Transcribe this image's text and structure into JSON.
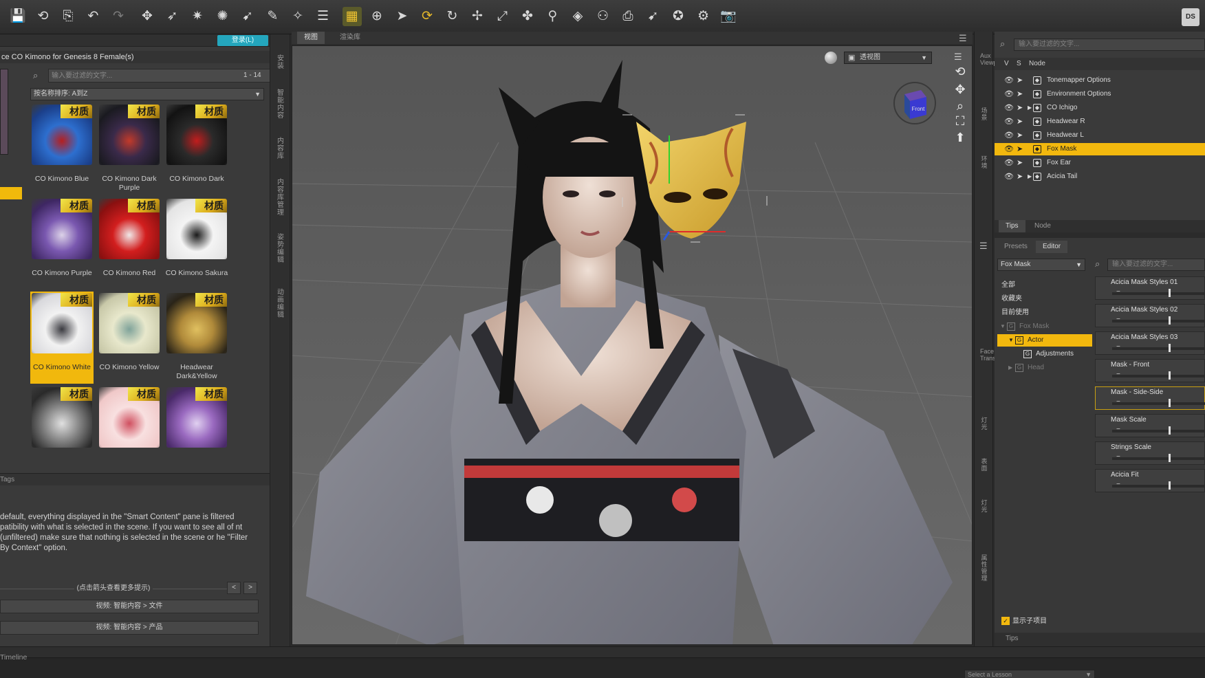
{
  "toolbar": {
    "buttons": [
      {
        "icon": "save-icon",
        "glyph": "💾"
      },
      {
        "icon": "undo-history-icon",
        "glyph": "⟲"
      },
      {
        "icon": "export-icon",
        "glyph": "⎘"
      },
      {
        "icon": "undo-icon",
        "glyph": "↶"
      },
      {
        "icon": "redo-icon",
        "glyph": "↷"
      },
      {
        "icon": "joint-editor-icon",
        "glyph": "✥"
      },
      {
        "icon": "active-pose-icon",
        "glyph": "➶"
      },
      {
        "icon": "node-weight-icon",
        "glyph": "✷"
      },
      {
        "icon": "geometry-editor-icon",
        "glyph": "✺"
      },
      {
        "icon": "transfer-icon",
        "glyph": "➹"
      },
      {
        "icon": "surface-selection-icon",
        "glyph": "✎"
      },
      {
        "icon": "spotrender-icon",
        "glyph": "✧"
      },
      {
        "icon": "align-icon",
        "glyph": "☰"
      },
      {
        "icon": "grid-icon",
        "glyph": "▦"
      },
      {
        "icon": "universal-tool-icon",
        "glyph": "⊕"
      },
      {
        "icon": "select-arrow-icon",
        "glyph": "➤"
      },
      {
        "icon": "rotate-gold-icon",
        "glyph": "⟳"
      },
      {
        "icon": "rotate-icon",
        "glyph": "↻"
      },
      {
        "icon": "translate-icon",
        "glyph": "✢"
      },
      {
        "icon": "scale-icon",
        "glyph": "⤢"
      },
      {
        "icon": "tweak-icon",
        "glyph": "✤"
      },
      {
        "icon": "figure-icon",
        "glyph": "⚲"
      },
      {
        "icon": "node-select-icon",
        "glyph": "◈"
      },
      {
        "icon": "group-icon",
        "glyph": "⚇"
      },
      {
        "icon": "camera-add-icon",
        "glyph": "⎙"
      },
      {
        "icon": "pointer-icon",
        "glyph": "➹"
      },
      {
        "icon": "spotlight-icon",
        "glyph": "✪"
      },
      {
        "icon": "render-settings-icon",
        "glyph": "⚙"
      },
      {
        "icon": "render-camera-icon",
        "glyph": "📷"
      }
    ],
    "logo": "DS"
  },
  "content_panel": {
    "login_label": "登录(L)",
    "product_title": "ce CO Kimono for Genesis 8 Female(s)",
    "search_placeholder": "输入要过滤的文字...",
    "range": "1 - 14",
    "sort_label": "按名称排序: A到Z",
    "badge": "材质",
    "items": [
      {
        "label": "CO Kimono Blue",
        "colors": [
          "#1b3f8a",
          "#2d6fcf",
          "#b51f1f"
        ]
      },
      {
        "label": "CO Kimono Dark Purple",
        "colors": [
          "#1a1a20",
          "#3a2a4a",
          "#c23a2a"
        ]
      },
      {
        "label": "CO Kimono Dark",
        "colors": [
          "#121212",
          "#2a2a2a",
          "#c21d1d"
        ]
      },
      {
        "label": "CO Kimono Purple",
        "colors": [
          "#3e2763",
          "#7a58b0",
          "#dcd2e8"
        ]
      },
      {
        "label": "CO Kimono Red",
        "colors": [
          "#8a1010",
          "#d21e1e",
          "#f0e8e8"
        ]
      },
      {
        "label": "CO Kimono Sakura",
        "colors": [
          "#e4e4e4",
          "#f4f4f4",
          "#1a1a1a"
        ]
      },
      {
        "label": "CO Kimono White",
        "colors": [
          "#d8d8dc",
          "#f2f2f2",
          "#3a3a40"
        ]
      },
      {
        "label": "CO Kimono Yellow",
        "colors": [
          "#c8c8a8",
          "#e8e8cc",
          "#7fa39a"
        ]
      },
      {
        "label": "Headwear Dark&Yellow",
        "colors": [
          "#2a2418",
          "#b08a3a",
          "#e0c060"
        ]
      },
      {
        "label": "",
        "colors": [
          "#2a2a2a",
          "#8a8a8a",
          "#e0e0e0"
        ]
      },
      {
        "label": "",
        "colors": [
          "#f0c8c8",
          "#f8e0e0",
          "#d05060"
        ]
      },
      {
        "label": "",
        "colors": [
          "#4a2a6a",
          "#9a6ac0",
          "#e0d0f0"
        ]
      }
    ],
    "tags_label": "Tags",
    "tips_text": "default, everything displayed in the \"Smart Content\" pane is filtered patibility with what is selected in the scene. If you want to see all of nt (unfiltered) make sure that nothing is selected in the scene or he \"Filter By Context\" option.",
    "hint": "(点击箭头查看更多提示)",
    "prev": "<",
    "next": ">",
    "link_files": "视频: 智能内容 > 文件",
    "link_products": "视频: 智能内容 > 产品"
  },
  "left_vtabs": [
    "安装",
    "智能内容",
    "内容库",
    "内容库管理",
    "姿势编辑",
    "动画编辑"
  ],
  "viewport": {
    "tabs": [
      "视图",
      "渲染库"
    ],
    "view_select": "透视图",
    "cube_label": "Front"
  },
  "right_vtabs": [
    "Aux Viewport",
    "场景",
    "环境",
    "Face Transfer",
    "灯光",
    "表面",
    "灯光",
    "属性管理"
  ],
  "scene_panel": {
    "search_placeholder": "输入要过滤的文字...",
    "columns": [
      "V",
      "S",
      "Node"
    ],
    "nodes": [
      {
        "label": "Tonemapper Options",
        "expandable": false,
        "selected": false
      },
      {
        "label": "Environment Options",
        "expandable": false,
        "selected": false
      },
      {
        "label": "CO Ichigo",
        "expandable": true,
        "selected": false
      },
      {
        "label": "Headwear R",
        "expandable": false,
        "selected": false
      },
      {
        "label": "Headwear L",
        "expandable": false,
        "selected": false
      },
      {
        "label": "Fox Mask",
        "expandable": false,
        "selected": true
      },
      {
        "label": "Fox Ear",
        "expandable": false,
        "selected": false
      },
      {
        "label": "Acicia Tail",
        "expandable": true,
        "selected": false
      }
    ],
    "tabs": [
      "Tips",
      "Node"
    ]
  },
  "param_panel": {
    "tabs": [
      "Presets",
      "Editor"
    ],
    "node_select": "Fox Mask",
    "search_placeholder": "输入要过滤的文字...",
    "tree": [
      {
        "label": "全部",
        "indent": 0,
        "state": "normal"
      },
      {
        "label": "收藏夹",
        "indent": 0,
        "state": "normal"
      },
      {
        "label": "目前使用",
        "indent": 0,
        "state": "normal"
      },
      {
        "label": "Fox Mask",
        "indent": 0,
        "state": "dimmed"
      },
      {
        "label": "Actor",
        "indent": 1,
        "state": "selected"
      },
      {
        "label": "Adjustments",
        "indent": 2,
        "state": "normal"
      },
      {
        "label": "Head",
        "indent": 1,
        "state": "dimmed"
      }
    ],
    "sliders": [
      {
        "label": "Acicia Mask Styles 01",
        "value": 0.6
      },
      {
        "label": "Acicia Mask Styles 02",
        "value": 0.6
      },
      {
        "label": "Acicia Mask Styles 03",
        "value": 0.6
      },
      {
        "label": "Mask - Front",
        "value": 0.6
      },
      {
        "label": "Mask - Side-Side",
        "value": 0.6
      },
      {
        "label": "Mask Scale",
        "value": 0.6
      },
      {
        "label": "Strings Scale",
        "value": 0.6
      },
      {
        "label": "Acicia Fit",
        "value": 0.6
      }
    ],
    "show_sub": "显示子项目"
  },
  "tips_bottom": "Tips",
  "timeline": "Timeline",
  "lesson_select": "Select a Lesson"
}
